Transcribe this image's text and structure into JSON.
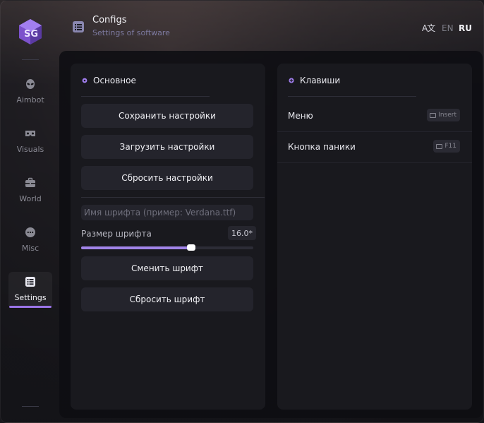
{
  "header": {
    "title": "Configs",
    "subtitle": "Settings of software",
    "lang_icon_text": "A文",
    "lang_en": "EN",
    "lang_ru": "RU",
    "active_lang": "RU"
  },
  "sidebar": {
    "items": [
      {
        "label": "Aimbot",
        "icon": "alien-icon"
      },
      {
        "label": "Visuals",
        "icon": "vr-goggles-icon"
      },
      {
        "label": "World",
        "icon": "briefcase-icon"
      },
      {
        "label": "Misc",
        "icon": "ellipsis-circle-icon"
      },
      {
        "label": "Settings",
        "icon": "list-icon",
        "active": true
      }
    ]
  },
  "general": {
    "title": "Основное",
    "save_label": "Сохранить настройки",
    "load_label": "Загрузить настройки",
    "reset_label": "Сбросить настройки",
    "font_placeholder": "Имя шрифта (пример: Verdana.ttf)",
    "font_size_label": "Размер шрифта",
    "font_size_value": "16.0*",
    "font_size_fraction": 0.64,
    "change_font_label": "Сменить шрифт",
    "reset_font_label": "Сбросить шрифт"
  },
  "keys": {
    "title": "Клавиши",
    "items": [
      {
        "label": "Меню",
        "key": "Insert"
      },
      {
        "label": "Кнопка паники",
        "key": "F11"
      }
    ]
  },
  "colors": {
    "accent": "#9a74e6",
    "slider_fill": "#a184e8"
  }
}
